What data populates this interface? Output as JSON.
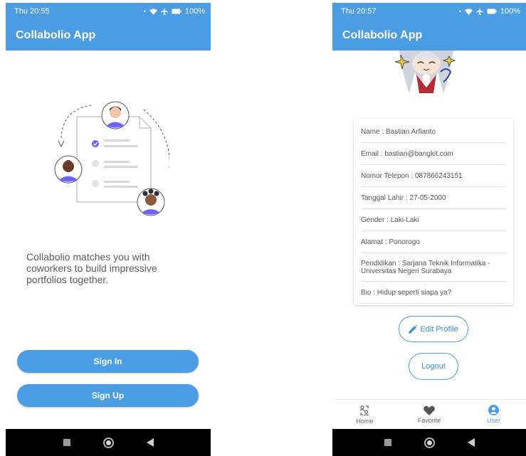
{
  "left_screen": {
    "status": {
      "time": "Thu 20:55",
      "battery": "100%"
    },
    "appbar": {
      "title": "Collabolio App"
    },
    "tagline": "Collabolio matches you with coworkers to build impressive portfolios together.",
    "buttons": {
      "sign_in": "Sign In",
      "sign_up": "Sign Up"
    },
    "icons": [
      "illustration-icon",
      "wifi-icon",
      "airplane-icon",
      "battery-icon",
      "recents-icon",
      "home-circle-icon",
      "back-icon"
    ]
  },
  "right_screen": {
    "status": {
      "time": "Thu 20:57",
      "battery": "100%"
    },
    "appbar": {
      "title": "Collabolio App"
    },
    "profile": {
      "name": "Name : Bastian Arfianto",
      "email": "Email : bastian@bangkit.com",
      "phone": "Nomor Telepon : 087866243151",
      "birth": "Tanggal Lahir : 27-05-2000",
      "gender": "Gender : Laki-Laki",
      "address": "Alamat : Ponorogo",
      "education": "Pendidikan : Sarjana Teknik Informatika - Universitas Negeri Surabaya",
      "bio": "Bio : Hidup seperti siapa ya?"
    },
    "buttons": {
      "edit_profile": "Edit Profile",
      "logout": "Logout"
    },
    "bottom_nav": {
      "home": "Home",
      "favorite": "Favorite",
      "user": "User",
      "active": "User"
    },
    "icons": [
      "avatar",
      "pencil-icon",
      "home-people-icon",
      "heart-icon",
      "user-circle-icon"
    ]
  },
  "colors": {
    "primary": "#4a9de3",
    "nav_bar": "#000000",
    "text": "#555555"
  }
}
